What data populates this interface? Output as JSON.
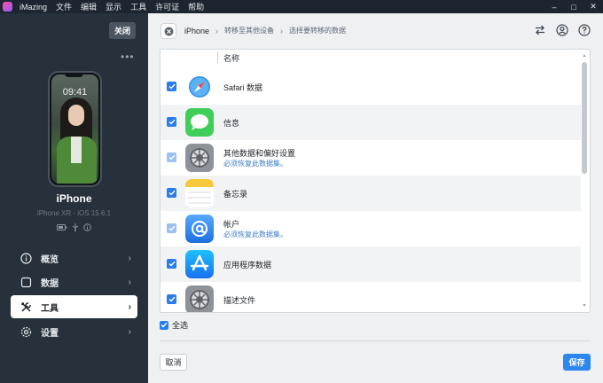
{
  "titlebar": {
    "app_name": "iMazing",
    "menu": [
      "文件",
      "编辑",
      "显示",
      "工具",
      "许可证",
      "帮助"
    ],
    "window_controls": {
      "minimize": "‒",
      "maximize": "□",
      "close": "✕"
    }
  },
  "sidebar": {
    "close_label": "关闭",
    "more_label": "•••",
    "phone_time": "09:41",
    "device_name": "iPhone",
    "device_model": "iPhone XR - iOS 15.6.1",
    "status_icons": [
      "battery-icon",
      "usb-icon",
      "info-icon"
    ],
    "nav": [
      {
        "label": "概览",
        "icon": "info-circle-icon",
        "active": false
      },
      {
        "label": "数据",
        "icon": "square-icon",
        "active": false
      },
      {
        "label": "工具",
        "icon": "tools-icon",
        "active": true
      },
      {
        "label": "设置",
        "icon": "gear-icon",
        "active": false
      }
    ],
    "chevron": "›"
  },
  "breadcrumb": {
    "items": [
      "iPhone",
      "转移至其他设备",
      "选择要转移的数据"
    ],
    "separator": "›"
  },
  "toolbar_icons": [
    "transfer-icon",
    "account-icon",
    "help-icon"
  ],
  "list": {
    "header": "名称",
    "rows": [
      {
        "title": "Safari 数据",
        "subtitle": "",
        "checked": true,
        "dimmed": false,
        "icon": "safari-icon"
      },
      {
        "title": "信息",
        "subtitle": "",
        "checked": true,
        "dimmed": false,
        "icon": "messages-icon"
      },
      {
        "title": "其他数据和偏好设置",
        "subtitle": "必须恢复此数据集。",
        "checked": true,
        "dimmed": true,
        "icon": "settings-icon"
      },
      {
        "title": "备忘录",
        "subtitle": "",
        "checked": true,
        "dimmed": false,
        "icon": "notes-icon"
      },
      {
        "title": "帐户",
        "subtitle": "必须恢复此数据集。",
        "checked": true,
        "dimmed": true,
        "icon": "accounts-icon"
      },
      {
        "title": "应用程序数据",
        "subtitle": "",
        "checked": true,
        "dimmed": false,
        "icon": "app-store-icon"
      },
      {
        "title": "描述文件",
        "subtitle": "",
        "checked": true,
        "dimmed": false,
        "icon": "profiles-icon"
      }
    ]
  },
  "select_all_label": "全选",
  "buttons": {
    "cancel": "取消",
    "save": "保存"
  },
  "colors": {
    "accent": "#2b7de9",
    "sidebar_bg": "#27313b",
    "titlebar_bg": "#1d2630",
    "save_button": "#2b86f0"
  }
}
